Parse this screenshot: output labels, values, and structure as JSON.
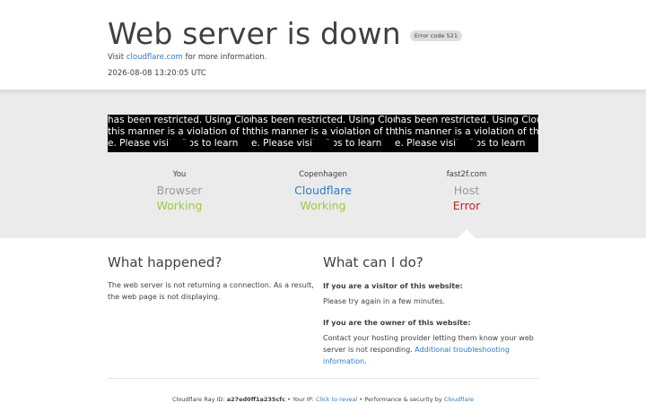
{
  "header": {
    "title": "Web server is down",
    "badge": "Error code 521",
    "visit_prefix": "Visit",
    "visit_link": "cloudflare.com",
    "visit_suffix": "for more information.",
    "timestamp": "2026-08-08 13:20:05 UTC"
  },
  "status_columns": [
    {
      "image_lines": [
        "has been restricted. Using Cloud",
        " this manner is a violation of the",
        "e. Please visit      e/tos to learn"
      ],
      "location": "You",
      "name": "Browser",
      "status": "Working"
    },
    {
      "image_lines": [
        "has been restricted. Using Cloud",
        " this manner is a violation of the",
        "e. Please visit      e/tos to learn"
      ],
      "location": "Copenhagen",
      "name": "Cloudflare",
      "status": "Working"
    },
    {
      "image_lines": [
        "has been restricted. Using Cloud",
        " this manner is a violation of the",
        "e. Please visit      e/tos to learn"
      ],
      "location": "fast2f.com",
      "name": "Host",
      "status": "Error"
    }
  ],
  "what_happened": {
    "heading": "What happened?",
    "body": "The web server is not returning a connection. As a result, the web page is not displaying."
  },
  "what_can_i_do": {
    "heading": "What can I do?",
    "visitor_heading": "If you are a visitor of this website:",
    "visitor_body": "Please try again in a few minutes.",
    "owner_heading": "If you are the owner of this website:",
    "owner_body": "Contact your hosting provider letting them know your web server is not responding.",
    "owner_link": "Additional troubleshooting information",
    "owner_end": "."
  },
  "footer": {
    "ray_label": "Cloudflare Ray ID:",
    "ray_id": "a27ed0ff1a235cfc",
    "sep1": "•",
    "ip_label": "Your IP:",
    "ip_link": "Click to reveal",
    "sep2": "•",
    "perf_label": "Performance & security by",
    "perf_link": "Cloudflare"
  },
  "colors": {
    "link": "#2f7bbf",
    "working": "#9bca3e",
    "error": "#bd2426",
    "muted": "#999999"
  }
}
